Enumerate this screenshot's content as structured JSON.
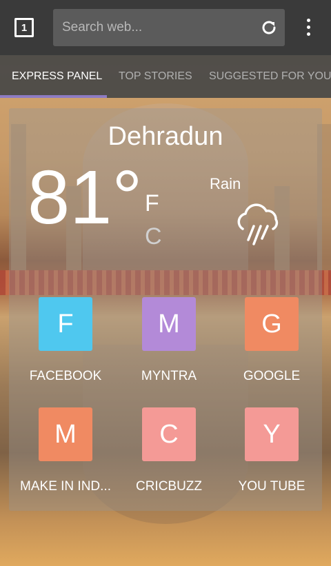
{
  "toolbar": {
    "tab_count": "1",
    "search_placeholder": "Search web..."
  },
  "tabs": [
    {
      "label": "EXPRESS PANEL",
      "active": true
    },
    {
      "label": "TOP STORIES",
      "active": false
    },
    {
      "label": "SUGGESTED FOR YOU",
      "active": false
    }
  ],
  "weather": {
    "city": "Dehradun",
    "temperature": "81°",
    "unit_f": "F",
    "unit_c": "C",
    "condition": "Rain",
    "icon": "rain-cloud-icon"
  },
  "speed_dial": [
    {
      "letter": "F",
      "label": "FACEBOOK",
      "color": "#4fc8ef"
    },
    {
      "letter": "M",
      "label": "MYNTRA",
      "color": "#b38ad8"
    },
    {
      "letter": "G",
      "label": "GOOGLE",
      "color": "#f08a62"
    },
    {
      "letter": "M",
      "label": "MAKE IN IND...",
      "color": "#f08a62"
    },
    {
      "letter": "C",
      "label": "CRICBUZZ",
      "color": "#f49a96"
    },
    {
      "letter": "Y",
      "label": "YOU TUBE",
      "color": "#f49a96"
    }
  ],
  "colors": {
    "tab_indicator": "#8e7cc3",
    "toolbar": "#3a3a3a"
  }
}
